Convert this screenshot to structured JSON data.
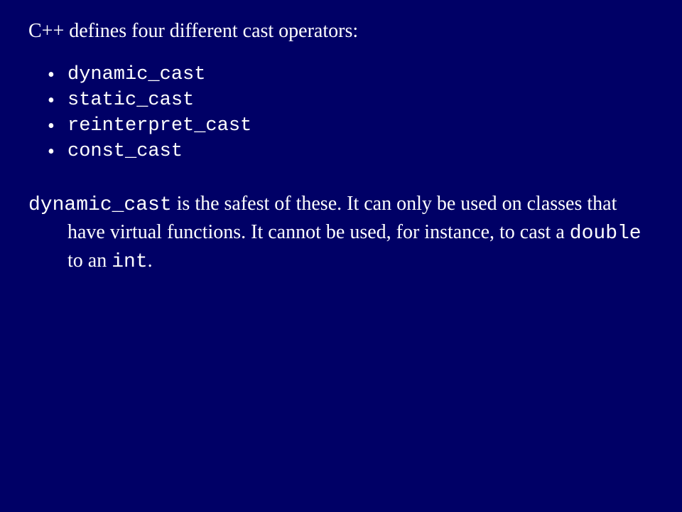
{
  "title": "C++ defines four different cast operators:",
  "bullets": [
    "dynamic_cast",
    "static_cast",
    "reinterpret_cast",
    "const_cast"
  ],
  "para": {
    "code1": "dynamic_cast",
    "text1": " is the safest of these.  It can only be used on classes that have virtual functions.  It cannot be used, for instance, to cast a ",
    "code2": "double",
    "text2": " to an ",
    "code3": "int",
    "text3": "."
  }
}
